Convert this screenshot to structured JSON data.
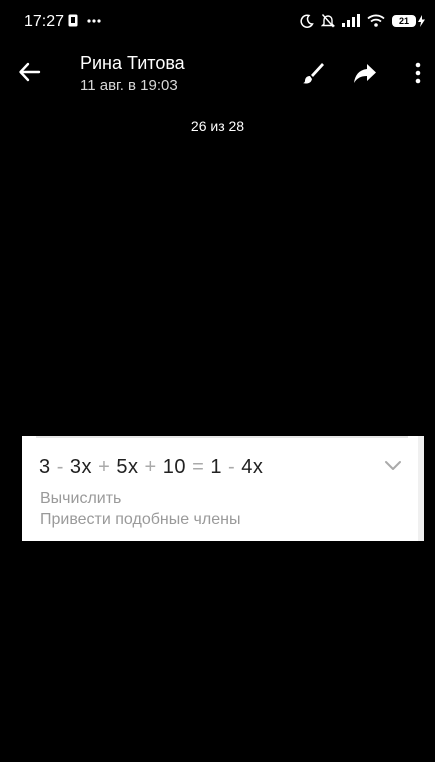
{
  "status_bar": {
    "time": "17:27",
    "battery": "21"
  },
  "header": {
    "sender": "Рина Титова",
    "date": "11 авг. в 19:03"
  },
  "viewer": {
    "counter": "26 из 28"
  },
  "photo": {
    "equation": {
      "t1": "3",
      "op1": "-",
      "t2": "3x",
      "op2": "+",
      "t3": "5x",
      "op3": "+",
      "t4": "10",
      "op4": "=",
      "t5": "1",
      "op5": "-",
      "t6": "4x"
    },
    "action_1": "Вычислить",
    "action_2": "Привести подобные члены"
  },
  "icons": {
    "back": "arrow-left-icon",
    "edit": "brush-icon",
    "share": "share-icon",
    "more": "more-vertical-icon",
    "expand": "chevron-down-icon"
  }
}
